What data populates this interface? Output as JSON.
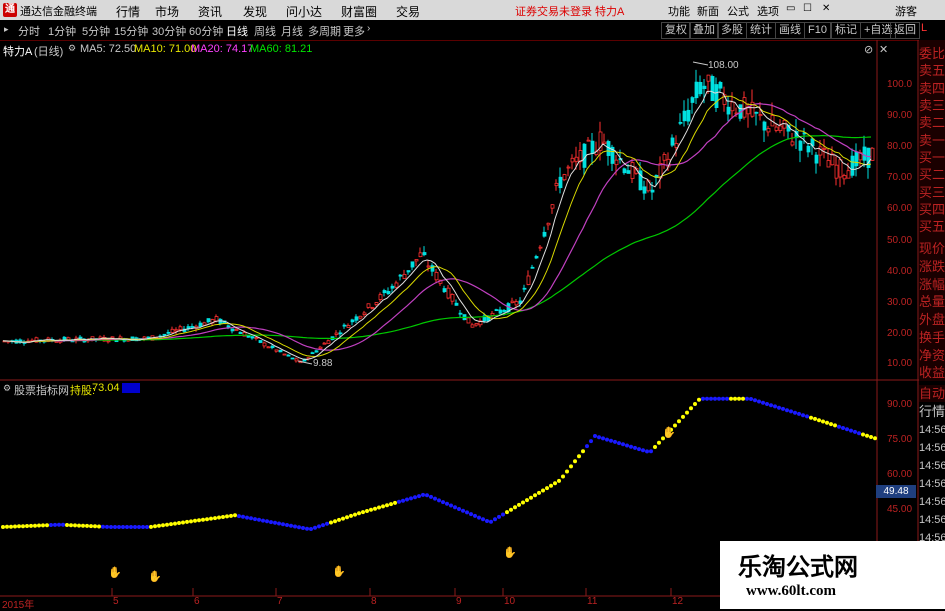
{
  "titlebar": {
    "app_title": "通达信金融终端",
    "menu": [
      "行情",
      "市场",
      "资讯",
      "发现",
      "问小达",
      "财富圈",
      "交易"
    ],
    "warning": "证券交易未登录 特力A",
    "links": [
      "功能",
      "新面",
      "公式",
      "选项"
    ],
    "guest": "游客"
  },
  "toolbar": {
    "periods": [
      "分时",
      "1分钟",
      "5分钟",
      "15分钟",
      "30分钟",
      "60分钟",
      "日线",
      "周线",
      "月线",
      "多周期",
      "更多"
    ],
    "active_period": "日线",
    "right_buttons": [
      "复权",
      "叠加",
      "多股",
      "统计",
      "画线",
      "F10",
      "标记",
      "+自选",
      "返回"
    ]
  },
  "main_chart": {
    "stock_label": "特力A",
    "period_label": "(日线)",
    "ma_legend": [
      {
        "text": "MA5: 72.50",
        "color": "#e0e0e0"
      },
      {
        "text": "MA10: 71.00",
        "color": "#e6e600"
      },
      {
        "text": "MA20: 74.17",
        "color": "#ff40ff"
      },
      {
        "text": "MA60: 81.21",
        "color": "#00e600"
      }
    ],
    "high_annotation": "108.00",
    "low_annotation": "9.88",
    "y_ticks": [
      "100.0",
      "90.00",
      "80.00",
      "70.00",
      "60.00",
      "50.00",
      "40.00",
      "30.00",
      "20.00",
      "10.00"
    ],
    "corner_mark": "L"
  },
  "indicator_panel": {
    "name": "股票指标网",
    "value_label": "持股:",
    "value": "73.04",
    "y_ticks": [
      "90.00",
      "75.00",
      "60.00",
      "45.00"
    ],
    "current_value": "49.48"
  },
  "x_axis": [
    "2015年",
    "5",
    "6",
    "7",
    "8",
    "9",
    "10",
    "11",
    "12"
  ],
  "sidebar": {
    "top_items": [
      "委比",
      "卖五",
      "卖四",
      "卖三",
      "卖二",
      "卖一",
      "买一",
      "买二",
      "买三",
      "买四",
      "买五",
      "现价",
      "涨跌",
      "涨幅",
      "总量",
      "外盘",
      "换手",
      "净资",
      "收益"
    ],
    "lower_items": [
      "自动",
      "行情"
    ],
    "times": [
      "14:56",
      "14:56",
      "14:56",
      "14:56",
      "14:56",
      "14:56",
      "14:56",
      "14:56"
    ]
  },
  "watermark": {
    "title": "乐淘公式网",
    "url": "www.60lt.com"
  },
  "colors": {
    "up": "#ff3030",
    "down": "#00e0e0",
    "axis": "#b22222",
    "hold_dots": "#ffff00",
    "empty_dots": "#1a1aff"
  },
  "chart_data": [
    {
      "type": "candlestick",
      "title": "特力A (日线)",
      "xlabel": "",
      "ylabel": "",
      "x": [
        "2015年",
        "5",
        "6",
        "7",
        "8",
        "9",
        "10",
        "11",
        "12"
      ],
      "ylim": [
        10,
        110
      ],
      "series": [
        {
          "name": "MA60",
          "values": [
            14,
            16,
            19,
            24,
            27,
            30,
            32,
            45,
            79,
            81
          ]
        },
        {
          "name": "close",
          "values": [
            17,
            18,
            22,
            31,
            10,
            30,
            45,
            22,
            85,
            105,
            90,
            72
          ]
        }
      ],
      "legend": "top-left"
    },
    {
      "type": "scatter",
      "title": "股票指标网",
      "xlabel": "",
      "ylabel": "",
      "x": [
        "2015年",
        "5",
        "6",
        "7",
        "8",
        "9",
        "10",
        "11",
        "12"
      ],
      "ylim": [
        35,
        95
      ],
      "series": [
        {
          "name": "持股",
          "values": [
            38,
            38,
            37,
            41,
            43,
            37,
            50,
            54,
            48,
            60,
            76,
            72,
            88,
            92,
            85,
            75
          ]
        }
      ]
    }
  ]
}
